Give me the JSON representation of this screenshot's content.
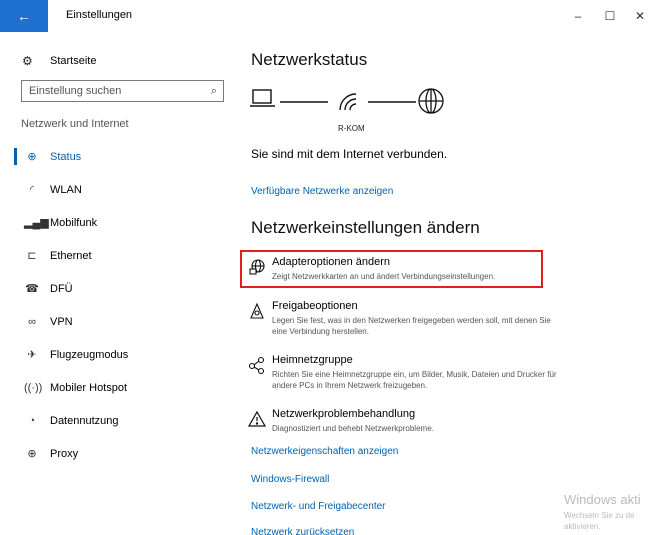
{
  "window": {
    "title": "Einstellungen",
    "back_icon": "←",
    "minimize": "–",
    "maximize": "☐",
    "close": "✕"
  },
  "sidebar": {
    "home_label": "Startseite",
    "search_placeholder": "Einstellung suchen",
    "group_label": "Netzwerk und Internet",
    "items": [
      {
        "label": "Status",
        "icon": "network-status-icon",
        "glyph": "⊕",
        "active": true
      },
      {
        "label": "WLAN",
        "icon": "wifi-icon",
        "glyph": "◜",
        "active": false
      },
      {
        "label": "Mobilfunk",
        "icon": "cellular-icon",
        "glyph": "▂▄▆",
        "active": false
      },
      {
        "label": "Ethernet",
        "icon": "ethernet-icon",
        "glyph": "⊏",
        "active": false
      },
      {
        "label": "DFÜ",
        "icon": "dialup-icon",
        "glyph": "☎",
        "active": false
      },
      {
        "label": "VPN",
        "icon": "vpn-icon",
        "glyph": "∞",
        "active": false
      },
      {
        "label": "Flugzeugmodus",
        "icon": "airplane-icon",
        "glyph": "✈",
        "active": false
      },
      {
        "label": "Mobiler Hotspot",
        "icon": "hotspot-icon",
        "glyph": "((·))",
        "active": false
      },
      {
        "label": "Datennutzung",
        "icon": "data-usage-icon",
        "glyph": "◔",
        "active": false
      },
      {
        "label": "Proxy",
        "icon": "proxy-icon",
        "glyph": "⊕",
        "active": false
      }
    ]
  },
  "main": {
    "status_title": "Netzwerkstatus",
    "network_name": "R-KOM",
    "connected_text": "Sie sind mit dem Internet verbunden.",
    "show_networks_link": "Verfügbare Netzwerke anzeigen",
    "change_title": "Netzwerkeinstellungen ändern",
    "options": [
      {
        "title": "Adapteroptionen ändern",
        "desc": "Zeigt Netzwerkkarten an und ändert Verbindungseinstellungen.",
        "icon": "adapter-icon"
      },
      {
        "title": "Freigabeoptionen",
        "desc": "Legen Sie fest, was in den Netzwerken freigegeben werden soll, mit denen Sie eine Verbindung herstellen.",
        "icon": "sharing-icon"
      },
      {
        "title": "Heimnetzgruppe",
        "desc": "Richten Sie eine Heimnetzgruppe ein, um Bilder, Musik, Dateien und Drucker für andere PCs in Ihrem Netzwerk freizugeben.",
        "icon": "homegroup-icon"
      },
      {
        "title": "Netzwerkproblembehandlung",
        "desc": "Diagnostiziert und behebt Netzwerkprobleme.",
        "icon": "troubleshoot-icon"
      }
    ],
    "links": [
      "Netzwerkeigenschaften anzeigen",
      "Windows-Firewall",
      "Netzwerk- und Freigabecenter",
      "Netzwerk zurücksetzen"
    ]
  },
  "watermark": {
    "title": "Windows akti",
    "line1": "Wechseln Sie zu de",
    "line2": "aktivieren."
  },
  "colors": {
    "accent": "#0063b1",
    "titlebar_back": "#1f6fd1",
    "highlight_border": "#e02020"
  }
}
